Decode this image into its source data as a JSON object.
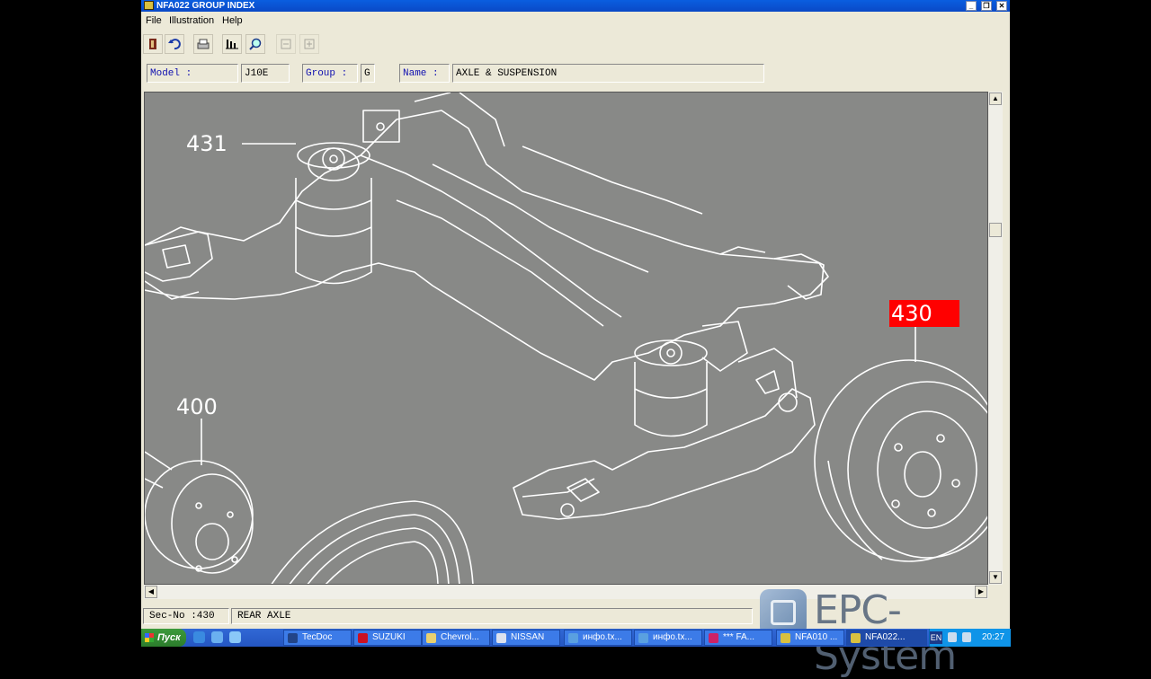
{
  "window": {
    "title": "NFA022 GROUP INDEX",
    "app_icon": "epc-app-icon",
    "controls": [
      "_",
      "❐",
      "✕"
    ]
  },
  "menu": [
    {
      "label": "File"
    },
    {
      "label": "Illustration"
    },
    {
      "label": "Help"
    }
  ],
  "toolbar": {
    "buttons": [
      {
        "icon": "exit-icon",
        "enabled": true
      },
      {
        "icon": "undo-icon",
        "enabled": true
      },
      {
        "icon": "print-icon",
        "enabled": true
      },
      {
        "icon": "parts-list-icon",
        "enabled": true
      },
      {
        "icon": "search-zoom-icon",
        "enabled": true
      },
      {
        "icon": "prev-page-icon",
        "enabled": false
      },
      {
        "icon": "next-page-icon",
        "enabled": false
      }
    ]
  },
  "info": {
    "model_label": "Model :",
    "model_value": "J10E",
    "group_label": "Group :",
    "group_value": "G",
    "name_label": "Name :",
    "name_value": "AXLE & SUSPENSION"
  },
  "illustration": {
    "background": "#888987",
    "callouts": [
      {
        "label": "431",
        "highlighted": false
      },
      {
        "label": "430",
        "highlighted": true,
        "highlight_color": "#ff0000"
      },
      {
        "label": "400",
        "highlighted": false
      }
    ]
  },
  "status": {
    "sec_label": "Sec-No :430",
    "sec_name": "REAR AXLE"
  },
  "watermark": {
    "text": "EPC-System"
  },
  "taskbar": {
    "start_label": "Пуск",
    "tasks": [
      {
        "label": "TecDoc",
        "color": "#224488"
      },
      {
        "label": "SUZUKI",
        "color": "#cc1122"
      },
      {
        "label": "Chevrol...",
        "color": "#e8d070"
      },
      {
        "label": "NISSAN",
        "color": "#dde2ee"
      },
      {
        "label": "инфо.tx...",
        "color": "#5aa0e0"
      },
      {
        "label": "инфо.tx...",
        "color": "#5aa0e0"
      },
      {
        "label": "*** FA...",
        "color": "#cc2266"
      },
      {
        "label": "NFA010 ...",
        "color": "#d8c040"
      },
      {
        "label": "NFA022...",
        "color": "#d8c040",
        "active": true
      }
    ],
    "tray": {
      "lang": "EN",
      "clock": "20:27"
    }
  }
}
